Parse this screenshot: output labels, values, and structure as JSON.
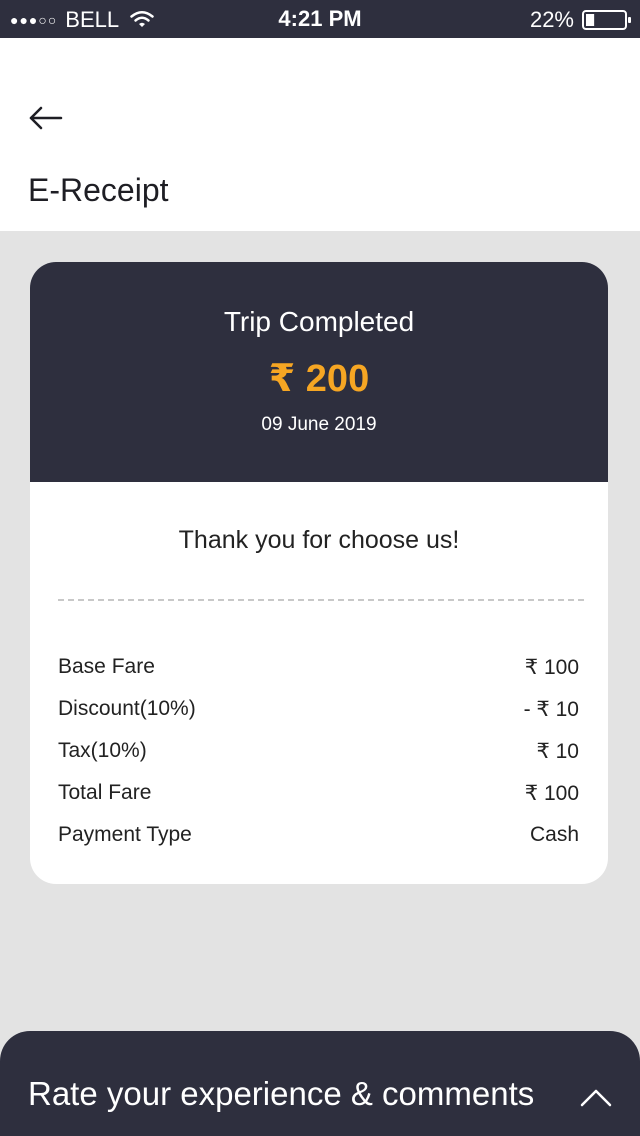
{
  "status_bar": {
    "signal": "●●●○○",
    "carrier": "BELL",
    "time": "4:21 PM",
    "battery": "22%",
    "battery_level": 0.22
  },
  "header": {
    "back_icon": "arrow-left-icon",
    "title": "E-Receipt"
  },
  "receipt": {
    "status": "Trip Completed",
    "amount": "₹ 200",
    "date": "09 June 2019",
    "thanks": "Thank you for choose us!",
    "rows": [
      {
        "label": "Base Fare",
        "value": "₹ 100"
      },
      {
        "label": "Discount(10%)",
        "value": "- ₹ 10"
      },
      {
        "label": "Tax(10%)",
        "value": "₹ 10"
      },
      {
        "label": "Total Fare",
        "value": "₹ 100"
      },
      {
        "label": "Payment Type",
        "value": "Cash"
      }
    ]
  },
  "rate_panel": {
    "label": "Rate your experience & comments",
    "icon": "chevron-up-icon"
  },
  "colors": {
    "dark": "#2e2f3e",
    "accent": "#f6a623",
    "background": "#e3e3e3"
  }
}
